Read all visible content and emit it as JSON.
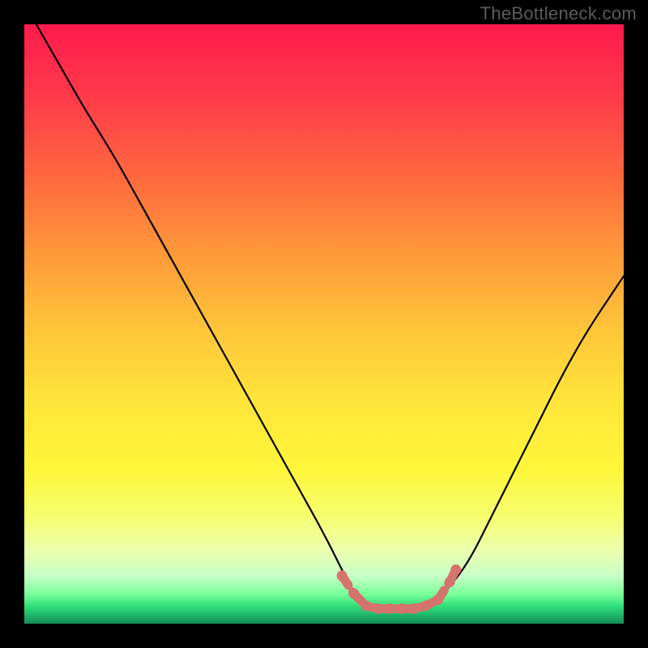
{
  "watermark": "TheBottleneck.com",
  "chart_data": {
    "type": "line",
    "title": "",
    "xlabel": "",
    "ylabel": "",
    "xlim": [
      0,
      100
    ],
    "ylim": [
      0,
      100
    ],
    "series": [
      {
        "name": "bottleneck-curve",
        "color": "#000000",
        "x": [
          2,
          6,
          10,
          15,
          20,
          25,
          30,
          35,
          40,
          45,
          50,
          53,
          55,
          57,
          59,
          61,
          63,
          65,
          67,
          70,
          74,
          78,
          82,
          86,
          90,
          94,
          98,
          100
        ],
        "y": [
          100,
          93,
          86,
          78,
          69,
          60,
          51,
          42,
          33,
          24,
          15,
          9,
          5,
          3,
          2,
          2,
          2,
          2,
          3,
          5,
          10,
          18,
          26,
          34,
          42,
          49,
          55,
          58
        ]
      },
      {
        "name": "bottleneck-zone-marker",
        "color": "#d5736d",
        "style": "dotted-thick",
        "x": [
          53,
          55,
          57,
          59,
          61,
          63,
          65,
          67,
          69,
          71,
          72
        ],
        "y": [
          8,
          5,
          3,
          2.5,
          2.5,
          2.5,
          2.5,
          3,
          4,
          7,
          9
        ]
      }
    ],
    "annotations": []
  }
}
